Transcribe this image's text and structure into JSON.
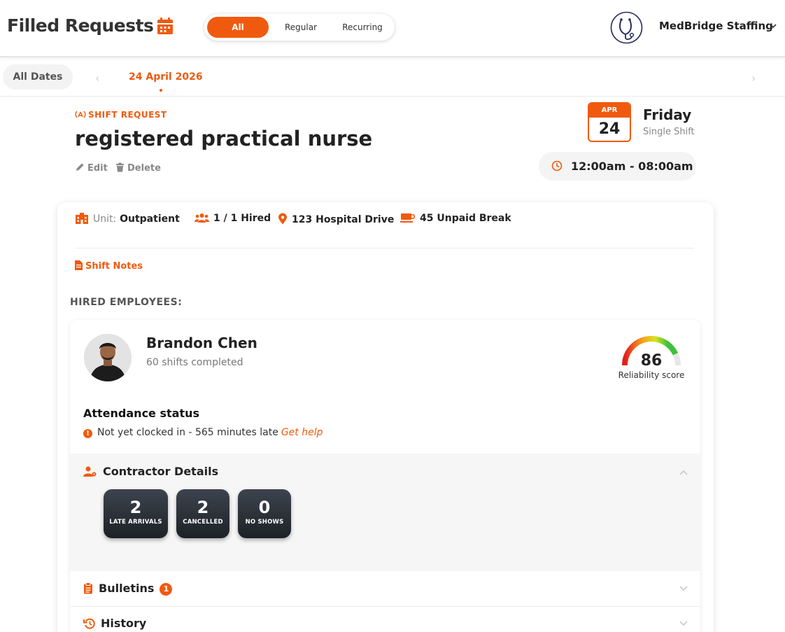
{
  "header": {
    "title": "Filled Requests",
    "filters": [
      "All",
      "Regular",
      "Recurring"
    ],
    "active_filter": "All",
    "org_name": "MedBridge Staffing"
  },
  "datebar": {
    "all_dates_label": "All Dates",
    "current_date": "24 April 2026"
  },
  "shift": {
    "tag": "SHIFT REQUEST",
    "title": "registered practical nurse",
    "edit_label": "Edit",
    "delete_label": "Delete",
    "month": "APR",
    "day": "24",
    "weekday": "Friday",
    "shift_type": "Single Shift",
    "time": "12:00am - 08:00am"
  },
  "details": {
    "unit_label": "Unit:",
    "unit_value": "Outpatient",
    "hired": "1 / 1 Hired",
    "address": "123 Hospital Drive",
    "break": "45 Unpaid Break",
    "notes_label": "Shift Notes",
    "hired_heading": "HIRED EMPLOYEES:"
  },
  "employee": {
    "name": "Brandon Chen",
    "shifts": "60 shifts completed",
    "score": 0.86,
    "score_text": "86",
    "score_label": "Reliability score",
    "attendance_heading": "Attendance status",
    "attendance_text": "Not yet clocked in - 565 minutes late",
    "get_help": "Get help"
  },
  "contractor": {
    "heading": "Contractor Details",
    "stats": [
      {
        "value": "2",
        "label": "LATE ARRIVALS"
      },
      {
        "value": "2",
        "label": "CANCELLED"
      },
      {
        "value": "0",
        "label": "NO SHOWS"
      }
    ]
  },
  "sections": {
    "bulletins": "Bulletins",
    "bulletins_count": "1",
    "history": "History"
  },
  "colors": {
    "accent": "#f05a0e",
    "dark": "#222222"
  },
  "icons": {
    "calendar": "calendar-icon",
    "logo": "stethoscope-logo-icon",
    "chevron": "chevron-down-icon"
  }
}
